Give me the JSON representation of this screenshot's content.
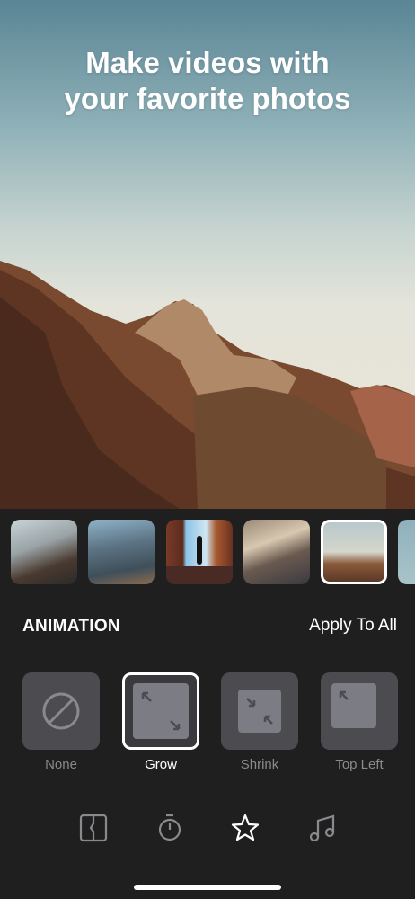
{
  "headline": "Make videos with your favorite photos",
  "headline_lines": [
    "Make videos with",
    "your favorite photos"
  ],
  "thumbnails": [
    {
      "name": "group-of-hikers",
      "selected": false
    },
    {
      "name": "canyon-hiker",
      "selected": false
    },
    {
      "name": "hiker-silhouette",
      "selected": false
    },
    {
      "name": "hikers-on-trail",
      "selected": false
    },
    {
      "name": "mountain-peak",
      "selected": true
    },
    {
      "name": "partial-next",
      "selected": false
    }
  ],
  "animation": {
    "title": "ANIMATION",
    "apply_all": "Apply To All",
    "options": [
      {
        "label": "None",
        "icon": "prohibited-icon",
        "selected": false
      },
      {
        "label": "Grow",
        "icon": "grow-arrows-icon",
        "selected": true
      },
      {
        "label": "Shrink",
        "icon": "shrink-arrows-icon",
        "selected": false
      },
      {
        "label": "Top Left",
        "icon": "top-left-arrow-icon",
        "selected": false
      }
    ]
  },
  "toolbar": [
    {
      "name": "crop",
      "icon": "split-frame-icon",
      "active": false
    },
    {
      "name": "duration",
      "icon": "stopwatch-icon",
      "active": false
    },
    {
      "name": "animation",
      "icon": "star-icon",
      "active": true
    },
    {
      "name": "music",
      "icon": "music-note-icon",
      "active": false
    }
  ],
  "colors": {
    "background": "#1f1f1f",
    "tile": "#4b4b50",
    "inactive": "#8a8a8e",
    "active": "#ffffff"
  }
}
